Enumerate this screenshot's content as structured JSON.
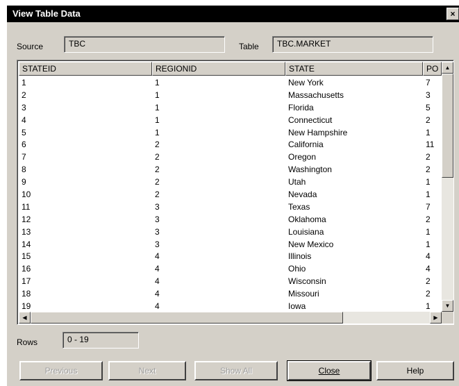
{
  "window": {
    "title": "View Table Data",
    "close_glyph": "×"
  },
  "source": {
    "label": "Source",
    "value": "TBC"
  },
  "table": {
    "label": "Table",
    "value": "TBC.MARKET"
  },
  "grid": {
    "columns": [
      "STATEID",
      "REGIONID",
      "STATE",
      "PO"
    ],
    "rows": [
      [
        "1",
        "1",
        "New York",
        "7"
      ],
      [
        "2",
        "1",
        "Massachusetts",
        "3"
      ],
      [
        "3",
        "1",
        "Florida",
        "5"
      ],
      [
        "4",
        "1",
        "Connecticut",
        "2"
      ],
      [
        "5",
        "1",
        "New Hampshire",
        "1"
      ],
      [
        "6",
        "2",
        "California",
        "11"
      ],
      [
        "7",
        "2",
        "Oregon",
        "2"
      ],
      [
        "8",
        "2",
        "Washington",
        "2"
      ],
      [
        "9",
        "2",
        "Utah",
        "1"
      ],
      [
        "10",
        "2",
        "Nevada",
        "1"
      ],
      [
        "11",
        "3",
        "Texas",
        "7"
      ],
      [
        "12",
        "3",
        "Oklahoma",
        "2"
      ],
      [
        "13",
        "3",
        "Louisiana",
        "1"
      ],
      [
        "14",
        "3",
        "New Mexico",
        "1"
      ],
      [
        "15",
        "4",
        "Illinois",
        "4"
      ],
      [
        "16",
        "4",
        "Ohio",
        "4"
      ],
      [
        "17",
        "4",
        "Wisconsin",
        "2"
      ],
      [
        "18",
        "4",
        "Missouri",
        "2"
      ],
      [
        "19",
        "4",
        "Iowa",
        "1"
      ]
    ]
  },
  "rows_field": {
    "label": "Rows",
    "value": "0 - 19"
  },
  "buttons": {
    "previous": "Previous",
    "next": "Next",
    "show_all": "Show All",
    "close": "Close",
    "help": "Help"
  },
  "icons": {
    "scroll_up": "scroll-up-arrow-icon",
    "scroll_down": "scroll-down-arrow-icon",
    "scroll_left": "scroll-left-arrow-icon",
    "scroll_right": "scroll-right-arrow-icon"
  }
}
